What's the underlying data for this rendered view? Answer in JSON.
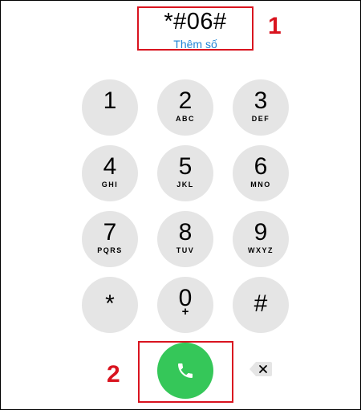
{
  "display": {
    "number": "*#06#",
    "add_number_label": "Thêm số"
  },
  "annotations": {
    "step1": "1",
    "step2": "2",
    "highlight_color": "#d9141f"
  },
  "keypad": {
    "keys": [
      {
        "digit": "1",
        "letters": ""
      },
      {
        "digit": "2",
        "letters": "ABC"
      },
      {
        "digit": "3",
        "letters": "DEF"
      },
      {
        "digit": "4",
        "letters": "GHI"
      },
      {
        "digit": "5",
        "letters": "JKL"
      },
      {
        "digit": "6",
        "letters": "MNO"
      },
      {
        "digit": "7",
        "letters": "PQRS"
      },
      {
        "digit": "8",
        "letters": "TUV"
      },
      {
        "digit": "9",
        "letters": "WXYZ"
      },
      {
        "digit": "*",
        "letters": ""
      },
      {
        "digit": "0",
        "letters": "+"
      },
      {
        "digit": "#",
        "letters": ""
      }
    ],
    "key_color": "#e5e5e5"
  },
  "actions": {
    "call_icon": "phone-icon",
    "call_color": "#35c759",
    "backspace_icon": "backspace-icon"
  }
}
